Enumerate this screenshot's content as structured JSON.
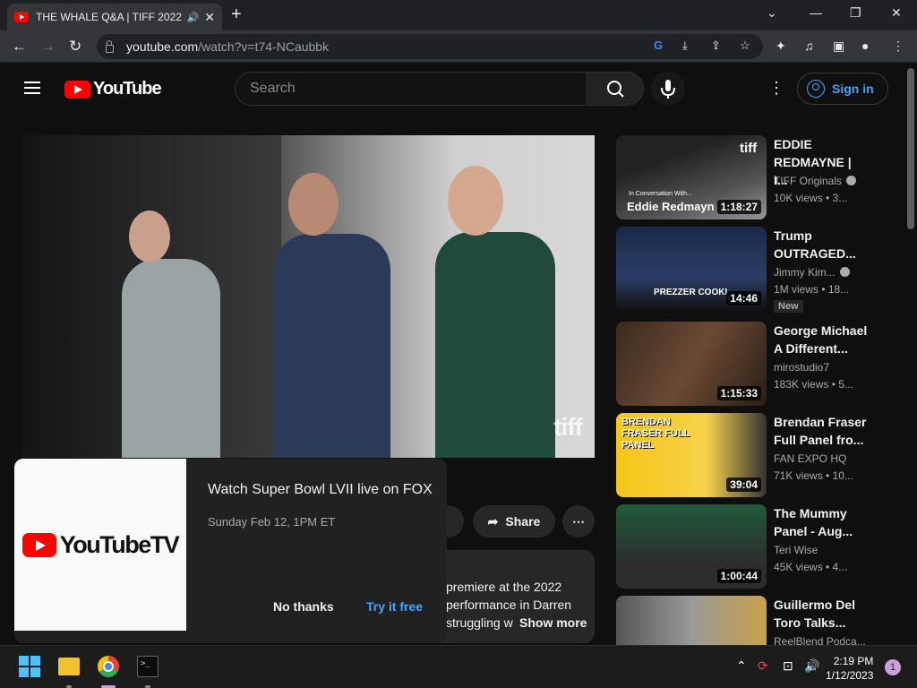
{
  "browser": {
    "tab_title": "THE WHALE Q&A | TIFF 2022",
    "url_host": "youtube.com",
    "url_path": "/watch?v=t74-NCaubbk"
  },
  "youtube": {
    "logo_text": "YouTube",
    "search_placeholder": "Search",
    "sign_in": "Sign in"
  },
  "video": {
    "watermark": "tiff",
    "share_label": "Share",
    "description_lines": [
      "premiere at the 2022",
      "performance in Darren",
      "struggling w"
    ],
    "show_more": "Show more"
  },
  "promo": {
    "brand": "YouTubeTV",
    "headline": "Watch Super Bowl LVII live on FOX",
    "subtext": "Sunday Feb 12, 1PM ET",
    "no_thanks": "No thanks",
    "try_free": "Try it free"
  },
  "recommendations": [
    {
      "title": "EDDIE REDMAYNE | I...",
      "channel": "TIFF Originals",
      "verified": true,
      "meta": "10K views • 3...",
      "duration": "1:18:27",
      "thumb_caption_small": "In Conversation With...",
      "thumb_caption": "Eddie Redmayn",
      "thumb_logo": "tiff"
    },
    {
      "title": "Trump OUTRAGED...",
      "channel": "Jimmy Kim...",
      "verified": true,
      "meta": "1M views • 18...",
      "badge": "New",
      "duration": "14:46",
      "thumb_caption": "PREZZER COOKI"
    },
    {
      "title": "George Michael A Different...",
      "channel": "mirostudio7",
      "verified": false,
      "meta": "183K views • 5...",
      "duration": "1:15:33"
    },
    {
      "title": "Brendan Fraser Full Panel fro...",
      "channel": "FAN EXPO HQ",
      "verified": false,
      "meta": "71K views • 10...",
      "duration": "39:04",
      "thumb_caption": "BRENDAN FRASER FULL PANEL"
    },
    {
      "title": "The Mummy Panel - Aug...",
      "channel": "Teri Wise",
      "verified": false,
      "meta": "45K views • 4...",
      "duration": "1:00:44"
    },
    {
      "title": "Guillermo Del Toro Talks...",
      "channel": "ReelBlend Podca...",
      "verified": false,
      "meta": ""
    }
  ],
  "taskbar": {
    "time": "2:19 PM",
    "date": "1/12/2023",
    "notifications": "1"
  },
  "colors": {
    "brand_red": "#ff0000",
    "link_blue": "#3ea6ff",
    "background": "#0f0f0f"
  }
}
